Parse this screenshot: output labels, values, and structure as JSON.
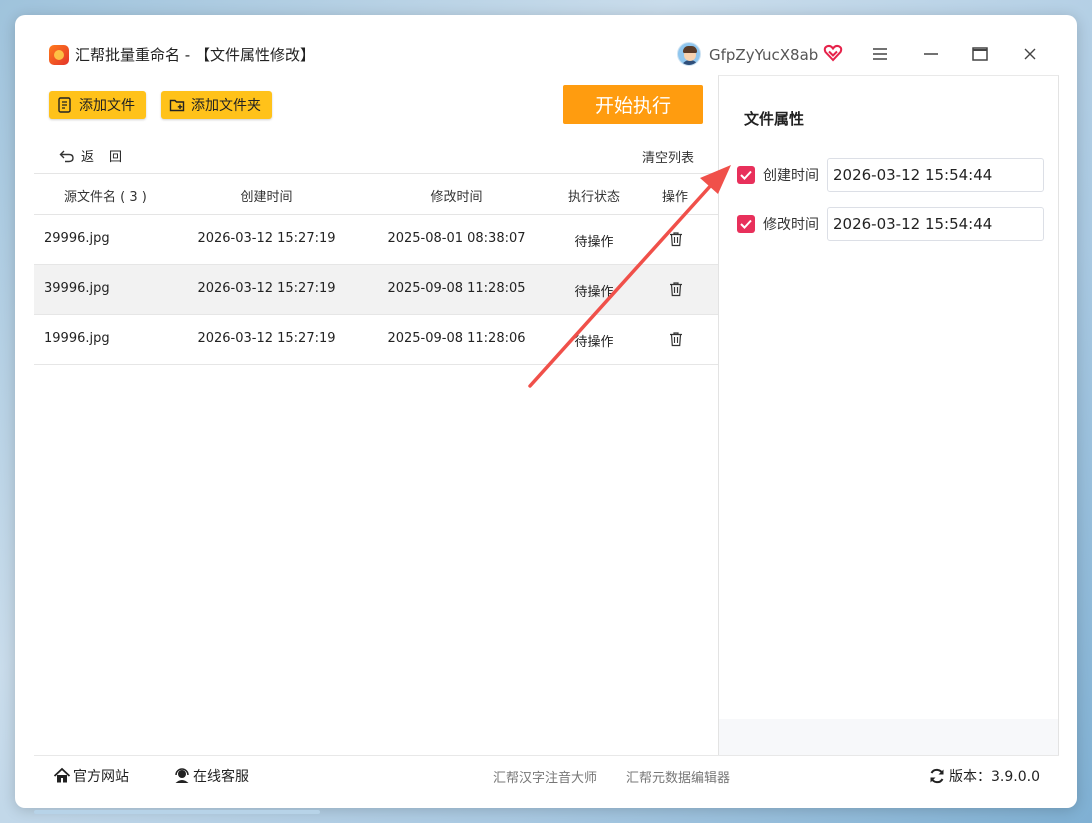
{
  "window": {
    "title": "汇帮批量重命名 - 【文件属性修改】",
    "username": "GfpZyYucX8ab"
  },
  "toolbar": {
    "add_file": "添加文件",
    "add_folder": "添加文件夹",
    "start": "开始执行",
    "back": "返回",
    "clear_list": "清空列表"
  },
  "table": {
    "headers": {
      "name": "源文件名 ( 3 )",
      "created": "创建时间",
      "modified": "修改时间",
      "status": "执行状态",
      "op": "操作"
    },
    "rows": [
      {
        "name": "29996.jpg",
        "created": "2026-03-12 15:27:19",
        "modified": "2025-08-01 08:38:07",
        "status": "待操作"
      },
      {
        "name": "39996.jpg",
        "created": "2026-03-12 15:27:19",
        "modified": "2025-09-08 11:28:05",
        "status": "待操作"
      },
      {
        "name": "19996.jpg",
        "created": "2026-03-12 15:27:19",
        "modified": "2025-09-08 11:28:06",
        "status": "待操作"
      }
    ]
  },
  "attributes": {
    "title": "文件属性",
    "created": {
      "label": "创建时间",
      "value": "2026-03-12 15:54:44",
      "checked": true
    },
    "modified": {
      "label": "修改时间",
      "value": "2026-03-12 15:54:44",
      "checked": true
    }
  },
  "footer": {
    "website": "官方网站",
    "support": "在线客服",
    "link1": "汇帮汉字注音大师",
    "link2": "汇帮元数据编辑器",
    "version": "版本：3.9.0.0"
  },
  "colors": {
    "accent_yellow": "#ffc21a",
    "start_orange": "#ff9c0f",
    "checkbox_red": "#e8305b",
    "arrow_red": "#f0504a"
  },
  "icons": [
    "app-logo-icon",
    "avatar",
    "vip-heart-icon",
    "menu-icon",
    "minimize-icon",
    "maximize-icon",
    "close-icon",
    "add-file-icon",
    "add-folder-icon",
    "back-arrow-icon",
    "trash-icon",
    "home-icon",
    "headset-icon",
    "refresh-icon"
  ]
}
